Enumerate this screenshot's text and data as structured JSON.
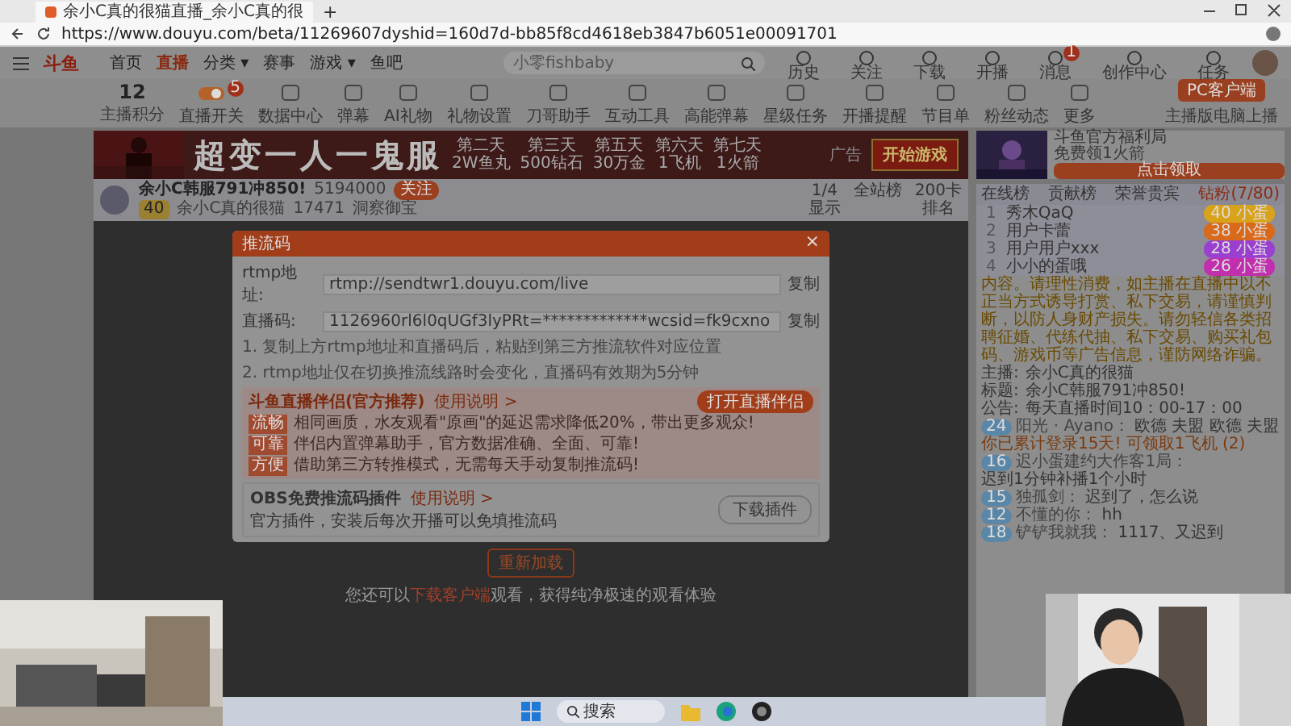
{
  "browser": {
    "tab_title": "余小C真的很猫直播_余小C真的很",
    "new_tab": "+",
    "url": "https://www.douyu.com/beta/11269607dyshid=160d7d-bb85f8cd4618eb3847b6051e00091701"
  },
  "header": {
    "logo": "斗鱼",
    "nav": [
      {
        "label": "首页",
        "selected": false
      },
      {
        "label": "直播",
        "selected": true
      },
      {
        "label": "分类 ▾",
        "selected": false
      },
      {
        "label": "赛事",
        "selected": false
      },
      {
        "label": "游戏 ▾",
        "selected": false
      },
      {
        "label": "鱼吧",
        "selected": false
      }
    ],
    "search": {
      "placeholder": "小零fishbaby"
    },
    "actions": [
      "历史",
      "关注",
      "下载",
      "开播",
      "消息",
      "创作中心",
      "任务"
    ],
    "message_badge": "1"
  },
  "toolbar": {
    "score": "12",
    "score_label": "主播积分",
    "items": [
      "直播开关",
      "数据中心",
      "弹幕",
      "AI礼物",
      "礼物设置",
      "刀哥助手",
      "互动工具",
      "高能弹幕",
      "星级任务",
      "开播提醒",
      "节目单",
      "粉丝动态",
      "更多"
    ],
    "switch_badge": "5",
    "client_button": "PC客户端",
    "client_note": "主播版电脑上播"
  },
  "banner": {
    "title": "超变一人一鬼服",
    "days": [
      {
        "day": "第二天",
        "reward": "2W鱼丸"
      },
      {
        "day": "第三天",
        "reward": "500钻石"
      },
      {
        "day": "第五天",
        "reward": "30万金"
      },
      {
        "day": "第六天",
        "reward": "1飞机"
      },
      {
        "day": "第七天",
        "reward": "1火箭"
      }
    ],
    "ad": "广告",
    "play_button": "开始游戏",
    "side_title": "斗鱼官方福利局",
    "side_note": "免费领1火箭",
    "side_button": "点击领取"
  },
  "streamer": {
    "name": "余小C韩服791冲850!",
    "room_id": "5194000",
    "follow": "关注",
    "level": "40",
    "guild": "余小C真的很猫",
    "fans": "17471",
    "hot": "洞察御宝"
  },
  "stats": [
    {
      "value": "1/4",
      "label": "显示"
    },
    {
      "value": "全站榜"
    },
    {
      "value": "200卡",
      "label": "排名"
    }
  ],
  "modal": {
    "title": "推流码",
    "close": "×",
    "fields": [
      {
        "label": "rtmp地址:",
        "value": "rtmp://sendtwr1.douyu.com/live",
        "copy": "复制"
      },
      {
        "label": "直播码:",
        "value": "1126960rl6l0qUGf3lyPRt=*************wcsid=fk9cxno",
        "copy": "复制"
      }
    ],
    "notes": [
      "1. 复制上方rtmp地址和直播码后，粘贴到第三方推流软件对应位置",
      "2. rtmp地址仅在切换推流线路时会变化，直播码有效期为5分钟"
    ],
    "companion": {
      "title": "斗鱼直播伴侣(官方推荐)",
      "help": "使用说明 >",
      "button": "打开直播伴侣",
      "features": [
        {
          "tag": "流畅",
          "text": "相同画质，水友观看\"原画\"的延迟需求降低20%，带出更多观众!"
        },
        {
          "tag": "可靠",
          "text": "伴侣内置弹幕助手，官方数据准确、全面、可靠!"
        },
        {
          "tag": "方便",
          "text": "借助第三方转推模式，无需每天手动复制推流码!"
        }
      ]
    },
    "plugin": {
      "title": "OBS免费推流码插件",
      "help": "使用说明 >",
      "text": "官方插件，安装后每次开播可以免填推流码",
      "button": "下载插件"
    }
  },
  "video": {
    "reload": "重新加载",
    "hint_before": "您还可以",
    "hint_link": "下载客户端",
    "hint_after": "观看，获得纯净极速的观看体验"
  },
  "chat": {
    "tabs": [
      {
        "label": "在线榜",
        "selected": false
      },
      {
        "label": "贡献榜",
        "selected": false
      },
      {
        "label": "荣誉贵宾",
        "selected": false
      },
      {
        "label": "钻粉(7/80)",
        "selected": true
      }
    ],
    "ranks": [
      {
        "rank": "1",
        "name": "秀木QaQ",
        "badge": "40 小蛋",
        "color": "#d9a21b"
      },
      {
        "rank": "2",
        "name": "用户卡蕾",
        "badge": "38 小蛋",
        "color": "#d96a1b"
      },
      {
        "rank": "3",
        "name": "用户用户xxx",
        "badge": "28 小蛋",
        "color": "#9b3fd1"
      },
      {
        "rank": "4",
        "name": "小小的蛋哦",
        "badge": "26 小蛋",
        "color": "#c22fae"
      }
    ],
    "notice": "内容。请理性消费，如主播在直播中以不正当方式诱导打赏、私下交易，请谨慎判断，以防人身财产损失。请勿轻信各类招聘征婚、代练代抽、私下交易、购买礼包码、游戏币等广告信息，谨防网络诈骗。",
    "info": [
      {
        "key": "主播:",
        "value": "余小C真的很猫"
      },
      {
        "key": "标题:",
        "value": "余小C韩服791冲850!"
      },
      {
        "key": "公告:",
        "value": "每天直播时间10：00-17：00"
      }
    ],
    "messages": [
      {
        "kind": "user",
        "level": "24",
        "user": "阳光 · Ayano：",
        "text": "欧德 夫盟 欧德 夫盟"
      },
      {
        "kind": "system",
        "text": "你已累计登录15天! 可领取1飞机 (2)"
      },
      {
        "kind": "user",
        "level": "16",
        "user": "迟小蛋建约大作客1局：",
        "text": "迟到1分钟补播1个小时"
      },
      {
        "kind": "user",
        "level": "15",
        "user": "独孤剑：",
        "text": "迟到了，怎么说"
      },
      {
        "kind": "user",
        "level": "12",
        "user": "不懂的你：",
        "text": "hh"
      },
      {
        "kind": "user",
        "level": "18",
        "user": "铲铲我就我：",
        "text": "1117、又迟到"
      }
    ]
  },
  "taskbar": {
    "search": "搜索"
  }
}
